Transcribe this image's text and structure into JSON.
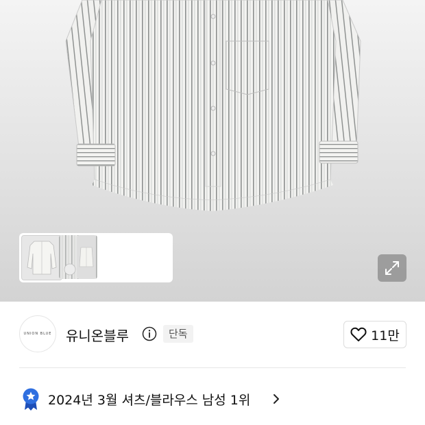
{
  "brand": {
    "logo_text": "UNION BLUE",
    "name": "유니온블루",
    "exclusive_label": "단독",
    "like_count": "11만"
  },
  "ranking": {
    "text": "2024년 3월 셔츠/블라우스 남성 1위"
  },
  "icons": {
    "info": "info-icon",
    "heart": "heart-icon",
    "expand": "expand-icon",
    "rank_badge": "star-ribbon-icon",
    "chevron": "chevron-right-icon"
  },
  "colors": {
    "rank_badge": "#2f6fe0",
    "text_primary": "#111111",
    "exclusive_bg": "#f2f2f2"
  },
  "gallery": {
    "thumbnails": [
      "shirt-front",
      "shirt-detail",
      "shirt-flat"
    ],
    "selected_index": 0
  }
}
